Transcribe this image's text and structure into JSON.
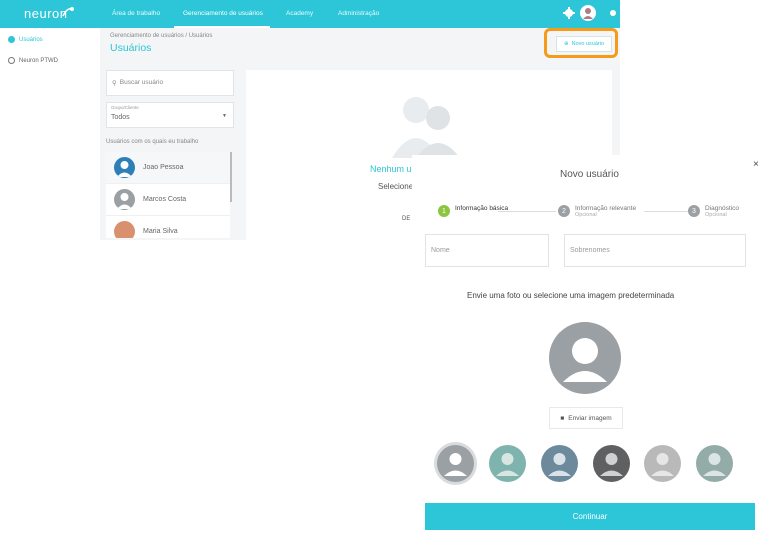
{
  "topbar": {
    "logo": "neuron",
    "nav": [
      "Área de trabalho",
      "Gerenciamento de usuários",
      "Academy",
      "Administração"
    ],
    "active_nav": 1
  },
  "sidebar": {
    "items": [
      {
        "label": "Usuários",
        "icon": "user-circle-icon",
        "active": true
      },
      {
        "label": "Neuron PTWD",
        "icon": "gear-icon",
        "active": false
      }
    ]
  },
  "page": {
    "breadcrumb": "Gerenciamento de usuários / Usuários",
    "title": "Usuários",
    "new_user_button": "Novo usuário"
  },
  "users_panel": {
    "search_placeholder": "Buscar usuário",
    "select_label": "Grupo/Cliente",
    "select_value": "Todos",
    "list_heading": "Usuários com os quais eu trabalho",
    "users": [
      {
        "name": "Joao Pessoa",
        "color": "#2e7fb8"
      },
      {
        "name": "Marcos Costa",
        "color": "#9aa0a3"
      },
      {
        "name": "Maria Silva",
        "color": "#d8906e"
      }
    ]
  },
  "detail_panel": {
    "empty_title": "Nenhum u",
    "empty_subtitle": "Selecione",
    "empty_small": "DE I"
  },
  "modal": {
    "title": "Novo usuário",
    "close": "×",
    "steps": [
      {
        "num": "1",
        "label": "Informação básica",
        "sub": "",
        "active": true
      },
      {
        "num": "2",
        "label": "Informação relevante",
        "sub": "Opcional",
        "active": false
      },
      {
        "num": "3",
        "label": "Diagnóstico",
        "sub": "Opcional",
        "active": false
      }
    ],
    "first_name_placeholder": "Nome",
    "last_name_placeholder": "Sobrenomes",
    "photo_prompt": "Envie uma foto ou selecione uma imagem predeterminada",
    "upload_button": "Enviar imagem",
    "presets": [
      "#9aa0a3",
      "#7fb4ae",
      "#6c8a9c",
      "#5e6062",
      "#b9b9b9",
      "#94aca8"
    ],
    "continue_button": "Continuar"
  },
  "colors": {
    "accent": "#2cc6d8",
    "highlight": "#f59a1b",
    "step_active": "#8cc63e"
  }
}
